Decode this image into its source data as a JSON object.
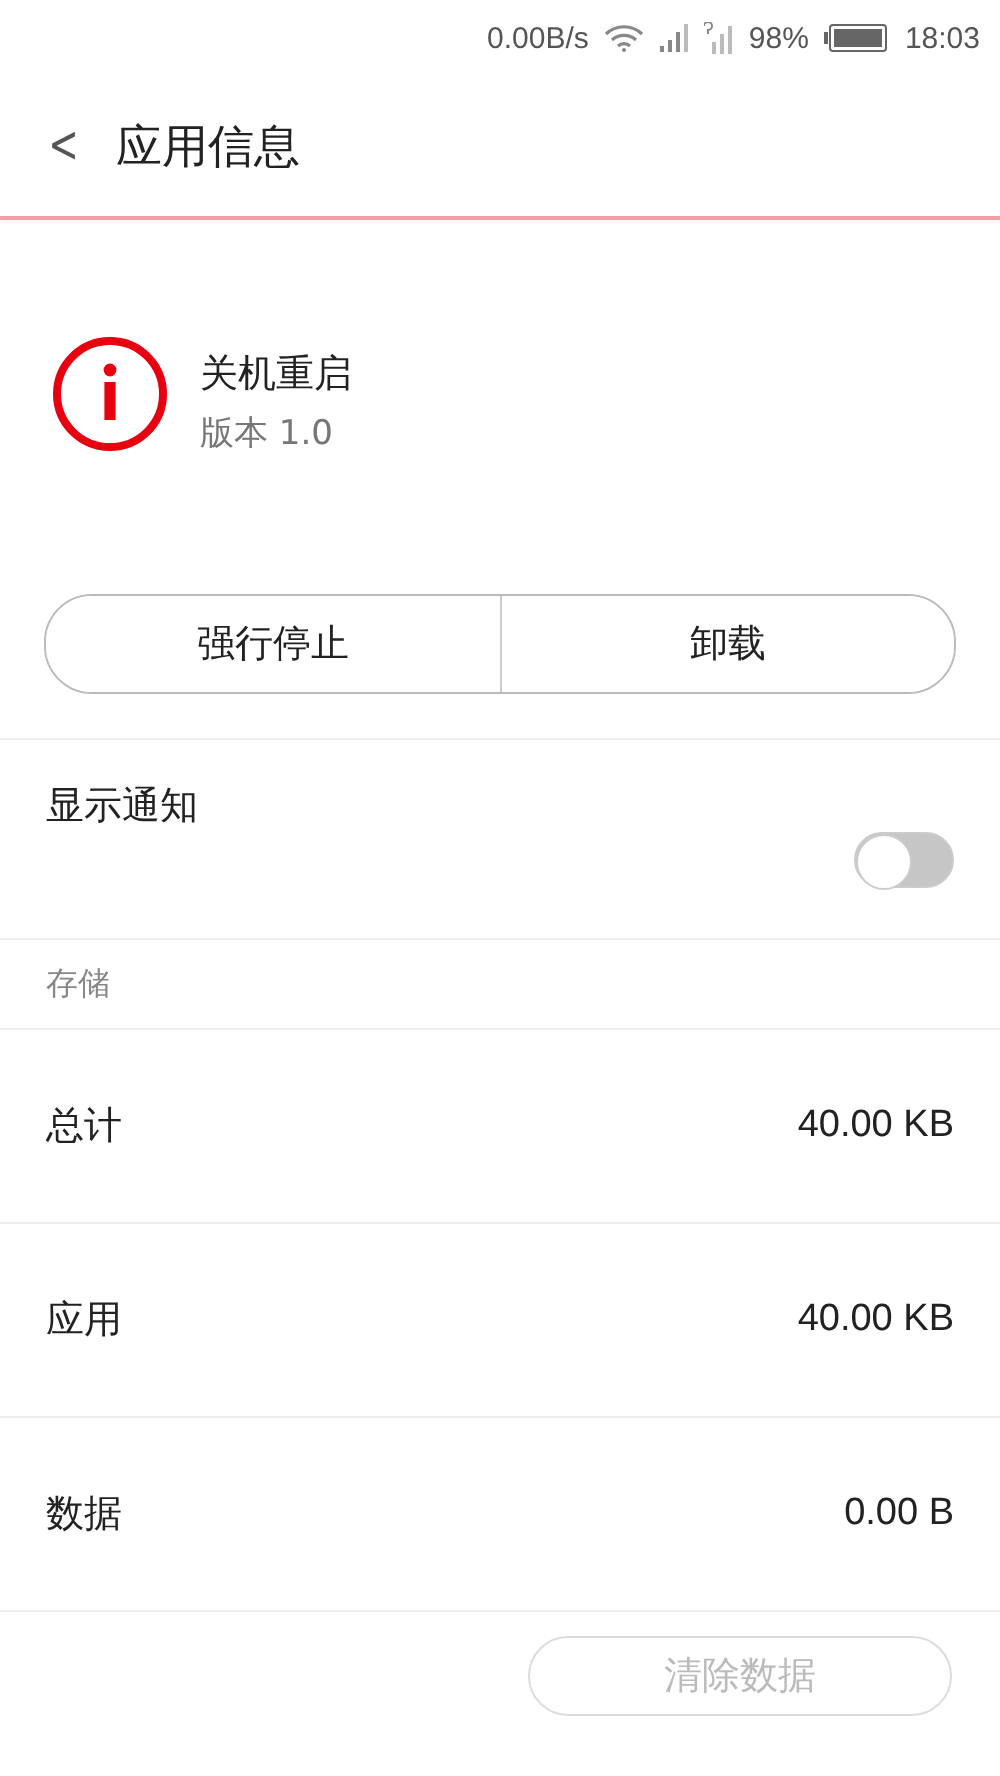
{
  "status_bar": {
    "speed": "0.00B/s",
    "battery": "98%",
    "time": "18:03"
  },
  "header": {
    "back": "<",
    "title": "应用信息"
  },
  "app": {
    "name": "关机重启",
    "version": "版本 1.0"
  },
  "actions": [
    {
      "label": "强行停止"
    },
    {
      "label": "卸载"
    }
  ],
  "notification": {
    "label": "显示通知",
    "on": false
  },
  "storage": {
    "heading": "存储",
    "rows": [
      {
        "label": "总计",
        "value": "40.00 KB"
      },
      {
        "label": "应用",
        "value": "40.00 KB"
      },
      {
        "label": "数据",
        "value": "0.00 B"
      }
    ]
  },
  "clear_button": {
    "label": "清除数据",
    "disabled": true
  }
}
